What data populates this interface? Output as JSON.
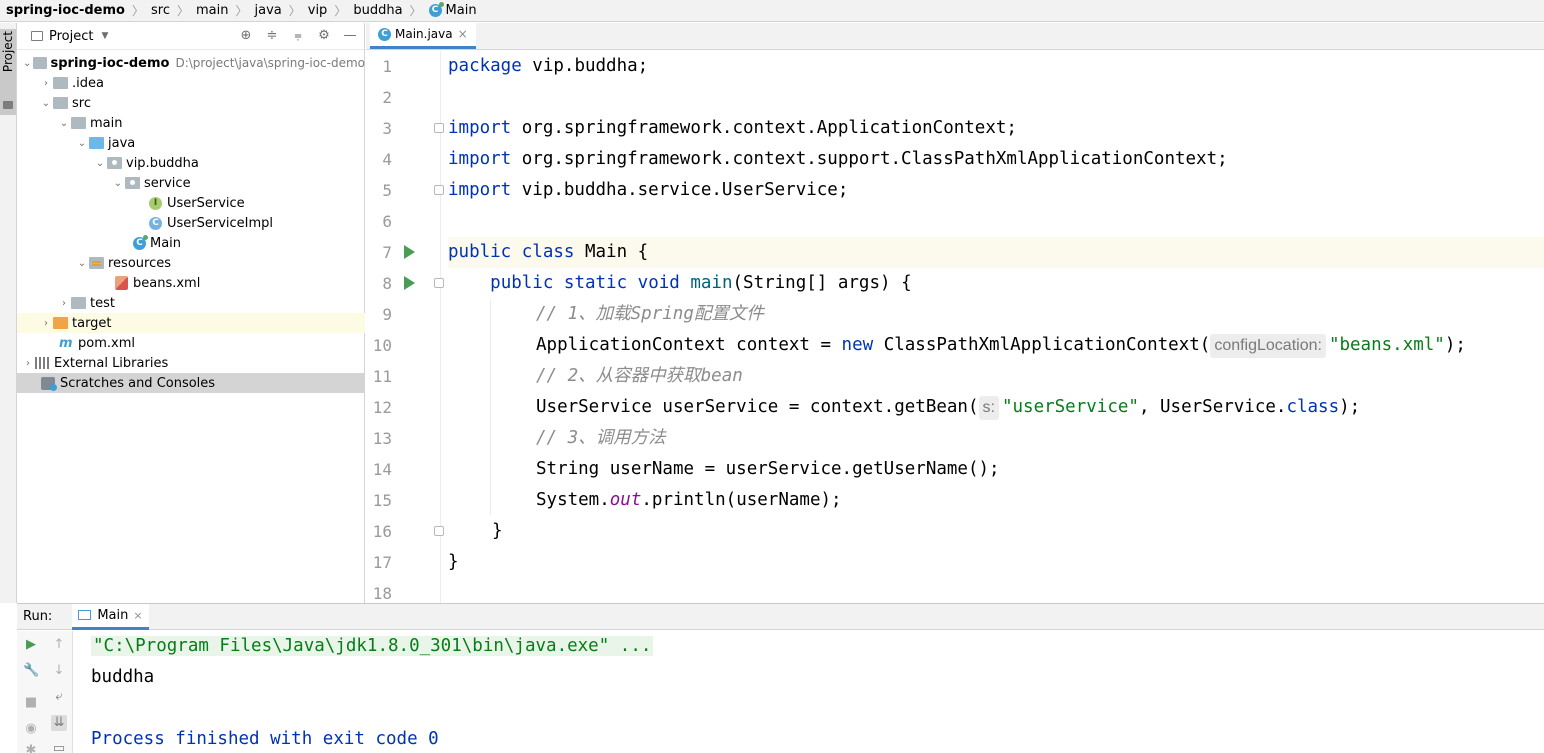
{
  "breadcrumb": [
    "spring-ioc-demo",
    "src",
    "main",
    "java",
    "vip",
    "buddha",
    "Main"
  ],
  "left_stripe": {
    "label": "Project"
  },
  "project_panel": {
    "title": "Project",
    "tree": [
      {
        "label": "spring-ioc-demo",
        "path": "D:\\project\\java\\spring-ioc-demo",
        "icon": "module-folder-icon",
        "expanded": true,
        "bold": true
      },
      {
        "label": ".idea",
        "icon": "folder-icon",
        "expanded": false
      },
      {
        "label": "src",
        "icon": "folder-icon",
        "expanded": true
      },
      {
        "label": "main",
        "icon": "folder-icon",
        "expanded": true
      },
      {
        "label": "java",
        "icon": "source-folder-icon",
        "expanded": true
      },
      {
        "label": "vip.buddha",
        "icon": "package-icon",
        "expanded": true
      },
      {
        "label": "service",
        "icon": "package-icon",
        "expanded": true
      },
      {
        "label": "UserService",
        "icon": "interface-icon"
      },
      {
        "label": "UserServiceImpl",
        "icon": "class-icon"
      },
      {
        "label": "Main",
        "icon": "main-class-icon"
      },
      {
        "label": "resources",
        "icon": "resources-folder-icon",
        "expanded": true
      },
      {
        "label": "beans.xml",
        "icon": "xml-file-icon"
      },
      {
        "label": "test",
        "icon": "folder-icon",
        "expanded": false
      },
      {
        "label": "target",
        "icon": "excluded-folder-icon",
        "expanded": false
      },
      {
        "label": "pom.xml",
        "icon": "maven-icon"
      },
      {
        "label": "External Libraries",
        "icon": "library-icon",
        "expanded": false
      },
      {
        "label": "Scratches and Consoles",
        "icon": "scratch-icon",
        "selected": true
      }
    ]
  },
  "editor": {
    "tab_label": "Main.java",
    "line_numbers": [
      "1",
      "2",
      "3",
      "4",
      "5",
      "6",
      "7",
      "8",
      "9",
      "10",
      "11",
      "12",
      "13",
      "14",
      "15",
      "16",
      "17",
      "18"
    ],
    "code": {
      "l1_kw": "package",
      "l1_rest": " vip.buddha;",
      "import_kw": "import",
      "l3_rest": " org.springframework.context.ApplicationContext;",
      "l4_rest": " org.springframework.context.support.ClassPathXmlApplicationContext;",
      "l5_rest": " vip.buddha.service.UserService;",
      "l7_kw": "public class",
      "l7_name": " Main",
      "l7_rest": " {",
      "l8_indent": "    ",
      "l8_kw": "public static void",
      "l8_meth": " main",
      "l8_rest": "(String[] args) {",
      "l9": "// 1、加载Spring配置文件",
      "l10_a": "ApplicationContext context = ",
      "l10_kw": "new",
      "l10_b": " ClassPathXmlApplicationContext(",
      "l10_hint": "configLocation:",
      "l10_str": "\"beans.xml\"",
      "l10_c": ");",
      "l11": "// 2、从容器中获取bean",
      "l12_a": "UserService userService = context.getBean(",
      "l12_hint": "s:",
      "l12_str": "\"userService\"",
      "l12_b": ", UserService.",
      "l12_kw": "class",
      "l12_c": ");",
      "l13": "// 3、调用方法",
      "l14": "String userName = userService.getUserName();",
      "l15_a": "System.",
      "l15_fld": "out",
      "l15_b": ".println(userName);",
      "l16": "}",
      "l17": "}"
    }
  },
  "run_panel": {
    "label": "Run:",
    "tab_label": "Main",
    "console": {
      "cmd": "\"C:\\Program Files\\Java\\jdk1.8.0_301\\bin\\java.exe\" ...",
      "output": "buddha",
      "exit": "Process finished with exit code 0"
    }
  },
  "colors": {
    "keyword": "#0033b3",
    "string": "#067d17",
    "comment": "#8c8c8c",
    "field": "#871094",
    "run_green": "#499c54",
    "selection_tab": "#4083c9"
  }
}
